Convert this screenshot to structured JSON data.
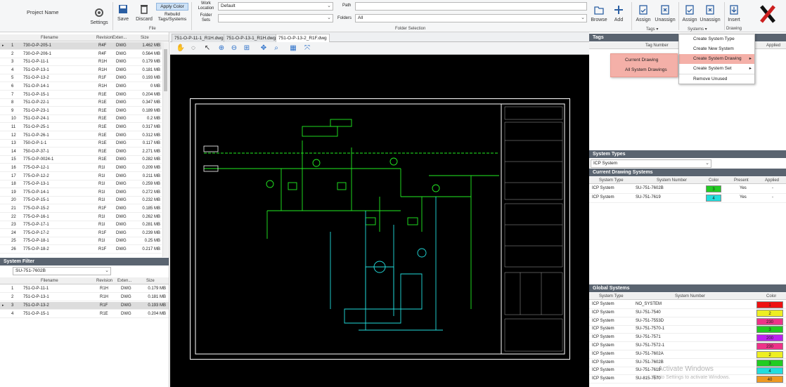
{
  "ribbon": {
    "project_name": "Project Name",
    "settings": "Settings",
    "save": "Save",
    "discard": "Discard",
    "apply_color": "Apply Color",
    "rebuild_tags": "Rebuild Tags/Systems",
    "file_group": "File",
    "work_location_label": "Work Location",
    "work_location_value": "Default",
    "folder_sets_label": "Folder Sets",
    "folder_sets_value": "",
    "path_label": "Path",
    "path_value": "",
    "folders_label": "Folders",
    "folders_value": "All",
    "folder_selection_group": "Folder Selection",
    "browse": "Browse",
    "add": "Add",
    "tags_assign": "Assign",
    "tags_unassign": "Unassign",
    "tags_group": "Tags",
    "systems_assign": "Assign",
    "systems_unassign": "Unassign",
    "systems_group": "Systems",
    "insert": "Insert",
    "drawing_group": "Drawing",
    "accent_color": "#1e5aa8"
  },
  "file_grid": {
    "headers": [
      "Filename",
      "Revision",
      "Exten...",
      "Size"
    ],
    "rows": [
      {
        "n": "1",
        "f": "730-O-P-205-1",
        "r": "R4F",
        "e": "DWG",
        "s": "1.462 MB",
        "sel": true
      },
      {
        "n": "2",
        "f": "730-O-P-206-1",
        "r": "R4F",
        "e": "DWG",
        "s": "0.564 MB"
      },
      {
        "n": "3",
        "f": "751-O-P-11-1",
        "r": "R1H",
        "e": "DWG",
        "s": "0.179 MB"
      },
      {
        "n": "4",
        "f": "751-O-P-13-1",
        "r": "R1H",
        "e": "DWG",
        "s": "0.181 MB"
      },
      {
        "n": "5",
        "f": "751-O-P-13-2",
        "r": "R1F",
        "e": "DWG",
        "s": "0.193 MB"
      },
      {
        "n": "6",
        "f": "751-O-P-14-1",
        "r": "R1H",
        "e": "DWG",
        "s": "0 MB"
      },
      {
        "n": "7",
        "f": "751-O-P-15-1",
        "r": "R1E",
        "e": "DWG",
        "s": "0.204 MB"
      },
      {
        "n": "8",
        "f": "751-O-P-22-1",
        "r": "R1E",
        "e": "DWG",
        "s": "0.347 MB"
      },
      {
        "n": "9",
        "f": "751-O-P-23-1",
        "r": "R1E",
        "e": "DWG",
        "s": "0.189 MB"
      },
      {
        "n": "10",
        "f": "751-O-P-24-1",
        "r": "R1E",
        "e": "DWG",
        "s": "0.2 MB"
      },
      {
        "n": "11",
        "f": "751-O-P-25-1",
        "r": "R1E",
        "e": "DWG",
        "s": "0.317 MB"
      },
      {
        "n": "12",
        "f": "751-O-P-26-1",
        "r": "R1E",
        "e": "DWG",
        "s": "0.312 MB"
      },
      {
        "n": "13",
        "f": "750-O-P-1-1",
        "r": "R1E",
        "e": "DWG",
        "s": "0.117 MB"
      },
      {
        "n": "14",
        "f": "750-O-P-37-1",
        "r": "R1E",
        "e": "DWG",
        "s": "2.271 MB"
      },
      {
        "n": "15",
        "f": "775-O-P-0024-1",
        "r": "R1E",
        "e": "DWG",
        "s": "0.282 MB"
      },
      {
        "n": "16",
        "f": "775-O-P-12-1",
        "r": "R1I",
        "e": "DWG",
        "s": "0.209 MB"
      },
      {
        "n": "17",
        "f": "775-O-P-12-2",
        "r": "R1I",
        "e": "DWG",
        "s": "0.211 MB"
      },
      {
        "n": "18",
        "f": "775-O-P-13-1",
        "r": "R1I",
        "e": "DWG",
        "s": "0.259 MB"
      },
      {
        "n": "19",
        "f": "775-O-P-14-1",
        "r": "R1I",
        "e": "DWG",
        "s": "0.272 MB"
      },
      {
        "n": "20",
        "f": "775-O-P-15-1",
        "r": "R1I",
        "e": "DWG",
        "s": "0.232 MB"
      },
      {
        "n": "21",
        "f": "775-O-P-15-2",
        "r": "R1F",
        "e": "DWG",
        "s": "0.185 MB"
      },
      {
        "n": "22",
        "f": "775-O-P-16-1",
        "r": "R1I",
        "e": "DWG",
        "s": "0.262 MB"
      },
      {
        "n": "23",
        "f": "775-O-P-17-1",
        "r": "R1I",
        "e": "DWG",
        "s": "0.281 MB"
      },
      {
        "n": "24",
        "f": "775-O-P-17-2",
        "r": "R1F",
        "e": "DWG",
        "s": "0.239 MB"
      },
      {
        "n": "25",
        "f": "775-O-P-18-1",
        "r": "R1I",
        "e": "DWG",
        "s": "0.25 MB"
      },
      {
        "n": "26",
        "f": "775-O-P-18-2",
        "r": "R1F",
        "e": "DWG",
        "s": "0.217 MB"
      }
    ]
  },
  "system_filter": {
    "title": "System Filter",
    "selected": "SU-751-7602B",
    "headers": [
      "Filename",
      "Revision",
      "Exten...",
      "Size"
    ],
    "rows": [
      {
        "n": "1",
        "f": "751-O-P-11-1",
        "r": "R1H",
        "e": "DWG",
        "s": "0.179 MB"
      },
      {
        "n": "2",
        "f": "751-O-P-13-1",
        "r": "R1H",
        "e": "DWG",
        "s": "0.181 MB"
      },
      {
        "n": "3",
        "f": "751-O-P-13-2",
        "r": "R1F",
        "e": "DWG",
        "s": "0.193 MB",
        "sel": true
      },
      {
        "n": "4",
        "f": "751-O-P-15-1",
        "r": "R1E",
        "e": "DWG",
        "s": "0.204 MB"
      }
    ]
  },
  "viewer": {
    "tabs": [
      "751-O-P-11-1_R1H.dwg",
      "751-O-P-13-1_R1H.dwg",
      "751-O-P-13-2_R1F.dwg"
    ],
    "active_tab": 2
  },
  "tags_panel": {
    "title": "Tags",
    "col_tag_number": "Tag Number",
    "col_applied": "Applied"
  },
  "context_menu": {
    "items": [
      "Create System Type",
      "Create New System",
      "Create System Drawing",
      "Create System Set",
      "Remove Unused"
    ],
    "submenu": [
      "Current Drawing",
      "All System Drawings"
    ]
  },
  "system_types": {
    "title": "System Types",
    "selected": "ICP System"
  },
  "current_drawing_systems": {
    "title": "Current Drawing Systems",
    "headers": [
      "System Type",
      "System Number",
      "Color",
      "Present",
      "Applied"
    ],
    "rows": [
      {
        "type": "ICP System",
        "number": "SU-751-7602B",
        "color": "3",
        "hex": "#22cc22",
        "present": "Yes",
        "applied": "-"
      },
      {
        "type": "ICP System",
        "number": "SU-751-7619",
        "color": "4",
        "hex": "#22dddd",
        "present": "Yes",
        "applied": "-"
      }
    ]
  },
  "global_systems": {
    "title": "Global Systems",
    "headers": [
      "System Type",
      "System Number",
      "Color"
    ],
    "rows": [
      {
        "type": "ICP System",
        "number": "NO_SYSTEM",
        "color": "1",
        "hex": "#ee1111"
      },
      {
        "type": "ICP System",
        "number": "SU-751-7540",
        "color": "2",
        "hex": "#eeee22"
      },
      {
        "type": "ICP System",
        "number": "SU-751-7553D",
        "color": "230",
        "hex": "#ee3388"
      },
      {
        "type": "ICP System",
        "number": "SU-751-7570-1",
        "color": "3",
        "hex": "#22cc22"
      },
      {
        "type": "ICP System",
        "number": "SU-751-7571",
        "color": "200",
        "hex": "#bb22ee"
      },
      {
        "type": "ICP System",
        "number": "SU-751-7572-1",
        "color": "230",
        "hex": "#ee3388"
      },
      {
        "type": "ICP System",
        "number": "SU-751-7602A",
        "color": "2",
        "hex": "#eeee22"
      },
      {
        "type": "ICP System",
        "number": "SU-751-7602B",
        "color": "3",
        "hex": "#22cc22"
      },
      {
        "type": "ICP System",
        "number": "SU-751-7619",
        "color": "4",
        "hex": "#22dddd"
      },
      {
        "type": "ICP System",
        "number": "SU-815-7570",
        "color": "40",
        "hex": "#ee9922"
      }
    ]
  },
  "watermark": {
    "line1": "Activate Windows",
    "line2": "Go to Settings to activate Windows."
  }
}
